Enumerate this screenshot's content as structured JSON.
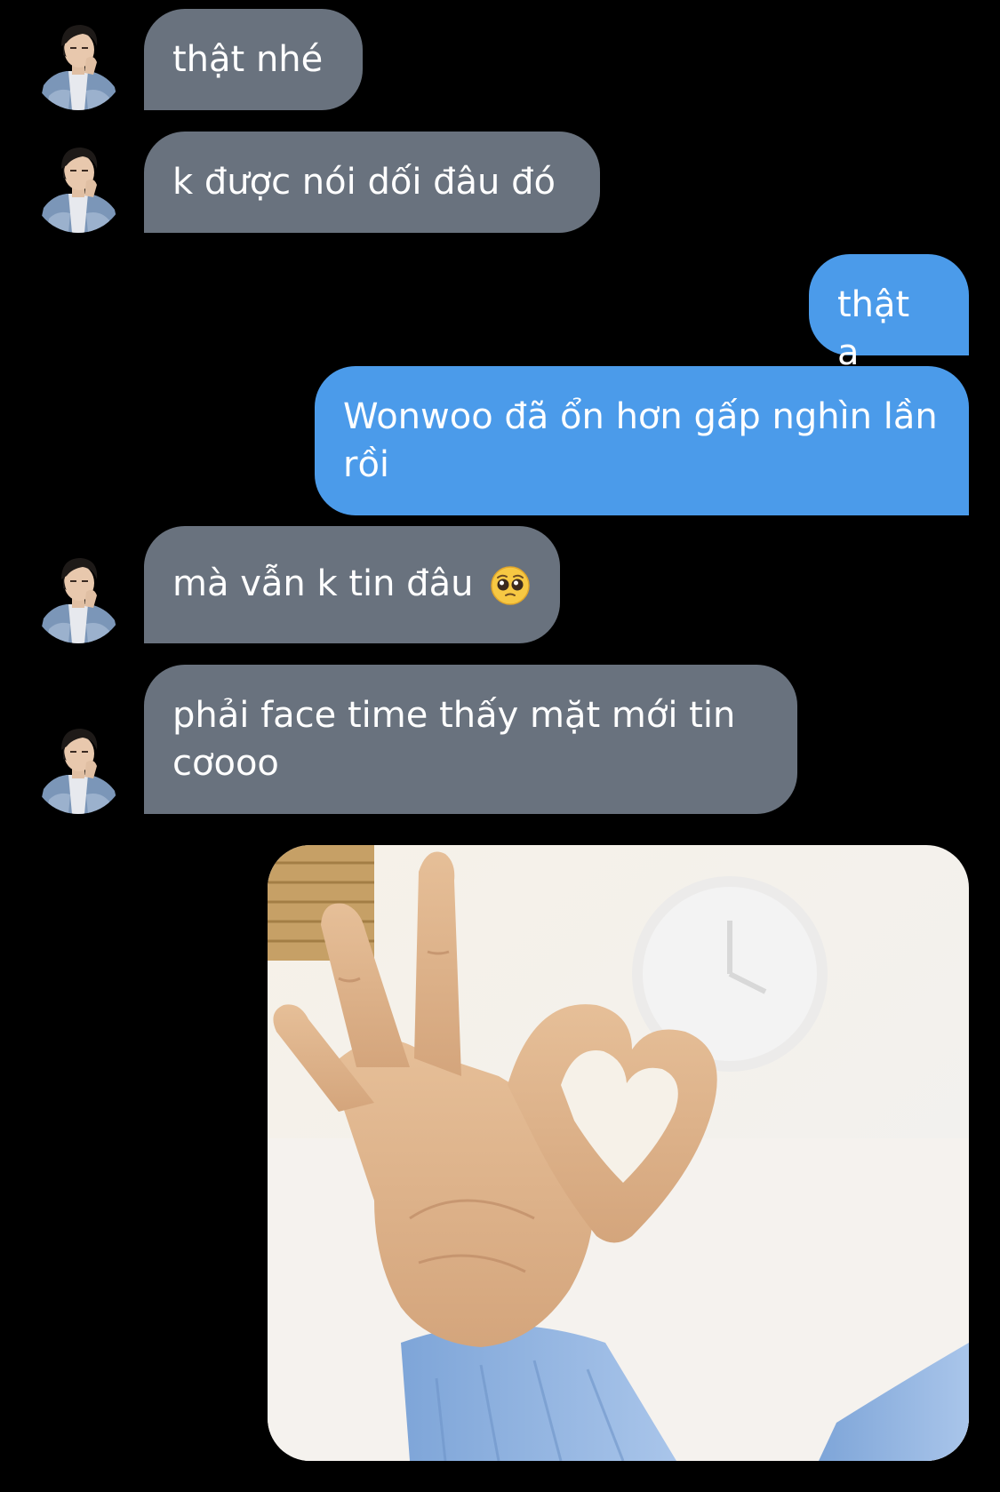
{
  "conversation": {
    "messages": [
      {
        "sender": "contact",
        "text": "thật nhé"
      },
      {
        "sender": "contact",
        "text": "k được nói dối đâu đó"
      },
      {
        "sender": "me",
        "text": "thật ạ"
      },
      {
        "sender": "me",
        "text": "Wonwoo đã ổn hơn gấp nghìn lần rồi"
      },
      {
        "sender": "contact",
        "text": "mà vẫn k tin đâu",
        "emoji": "pleading-face-emoji"
      },
      {
        "sender": "contact",
        "text": "phải face time thấy mặt mới tin cơooo"
      },
      {
        "sender": "me",
        "attachment": "photo",
        "description_icon": "heart-hand-photo"
      }
    ]
  },
  "colors": {
    "background": "#000000",
    "incoming_bubble": "#69727e",
    "outgoing_bubble": "#4b9bea",
    "text": "#ffffff"
  },
  "icons": {
    "avatar": "contact-avatar",
    "emoji": "pleading-face-emoji"
  }
}
